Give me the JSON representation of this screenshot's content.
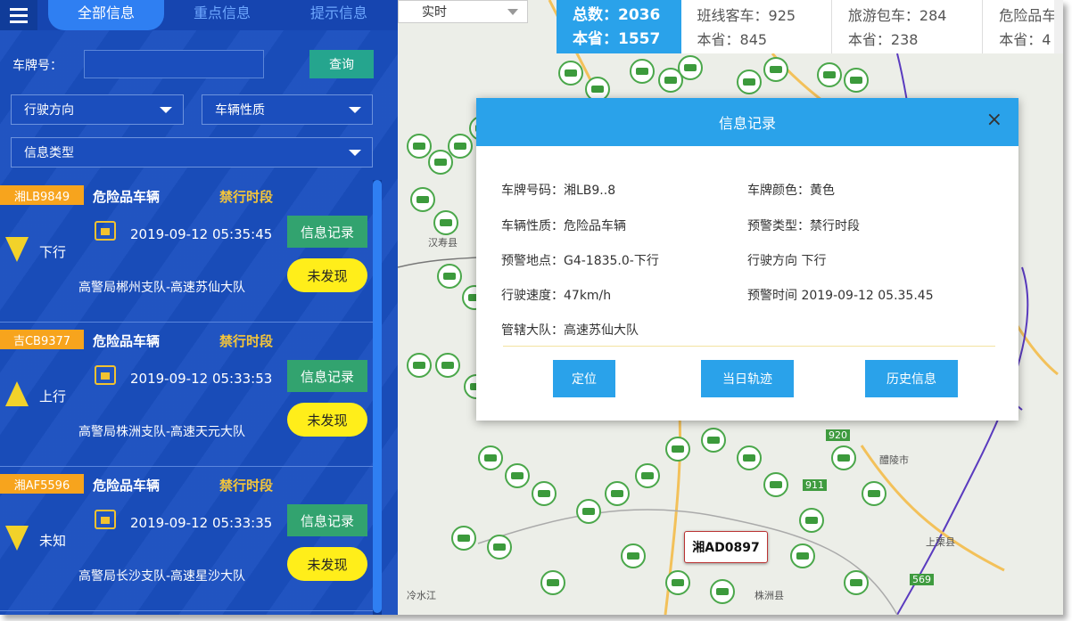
{
  "tabs": [
    "全部信息",
    "重点信息",
    "提示信息"
  ],
  "search": {
    "plate_label": "车牌号：",
    "plate_value": "",
    "query_button": "查询",
    "direction_select": "行驶方向",
    "nature_select": "车辆性质",
    "type_select": "信息类型"
  },
  "list": [
    {
      "plate": "湘LB9849",
      "vehicle_type": "危险品车辆",
      "alert": "禁行时段",
      "direction": "下行",
      "direction_arrow": "down",
      "time": "2019-09-12 05:35:45",
      "record_button": "信息记录",
      "status": "未发现",
      "unit": "高警局郴州支队-高速苏仙大队"
    },
    {
      "plate": "吉CB9377",
      "vehicle_type": "危险品车辆",
      "alert": "禁行时段",
      "direction": "上行",
      "direction_arrow": "up",
      "time": "2019-09-12 05:33:53",
      "record_button": "信息记录",
      "status": "未发现",
      "unit": "高警局株洲支队-高速天元大队"
    },
    {
      "plate": "湘AF5596",
      "vehicle_type": "危险品车辆",
      "alert": "禁行时段",
      "direction": "未知",
      "direction_arrow": "down",
      "time": "2019-09-12 05:33:35",
      "record_button": "信息记录",
      "status": "未发现",
      "unit": "高警局长沙支队-高速星沙大队"
    }
  ],
  "top": {
    "time_select": "实时",
    "stats": [
      {
        "line1": "总数：2036",
        "line2": "本省：1557"
      },
      {
        "line1": "班线客车：925",
        "line2": "本省：845"
      },
      {
        "line1": "旅游包车：284",
        "line2": "本省：238"
      },
      {
        "line1": "危险品车",
        "line2": "本省：4"
      }
    ]
  },
  "modal": {
    "title": "信息记录",
    "close": "×",
    "fields": {
      "plate_no": "车牌号码：湘LB9..8",
      "plate_color": "车牌颜色：黄色",
      "vehicle_nature": "车辆性质：危险品车辆",
      "alarm_type": "预警类型：禁行时段",
      "alarm_location": "预警地点：G4-1835.0-下行",
      "direction": "行驶方向  下行",
      "speed": "行驶速度：47km/h",
      "alarm_time": "预警时间  2019-09-12 05.35.45",
      "brigade": "管辖大队：高速苏仙大队"
    },
    "buttons": {
      "locate": "定位",
      "track": "当日轨迹",
      "history": "历史信息"
    }
  },
  "map": {
    "plate_tag": "湘AD0897",
    "places": [
      "汉寿县",
      "上栗县",
      "醴陵市",
      "株洲县",
      "冷水江"
    ],
    "road_shields": [
      "920",
      "911",
      "569"
    ]
  },
  "colors": {
    "panel": "#1a4fbf",
    "accent": "#2aa2ea",
    "plate_tag": "#f7a41d",
    "alert": "#f4c53a",
    "status_btn": "#ffee1a",
    "record_btn": "#32a36f"
  }
}
